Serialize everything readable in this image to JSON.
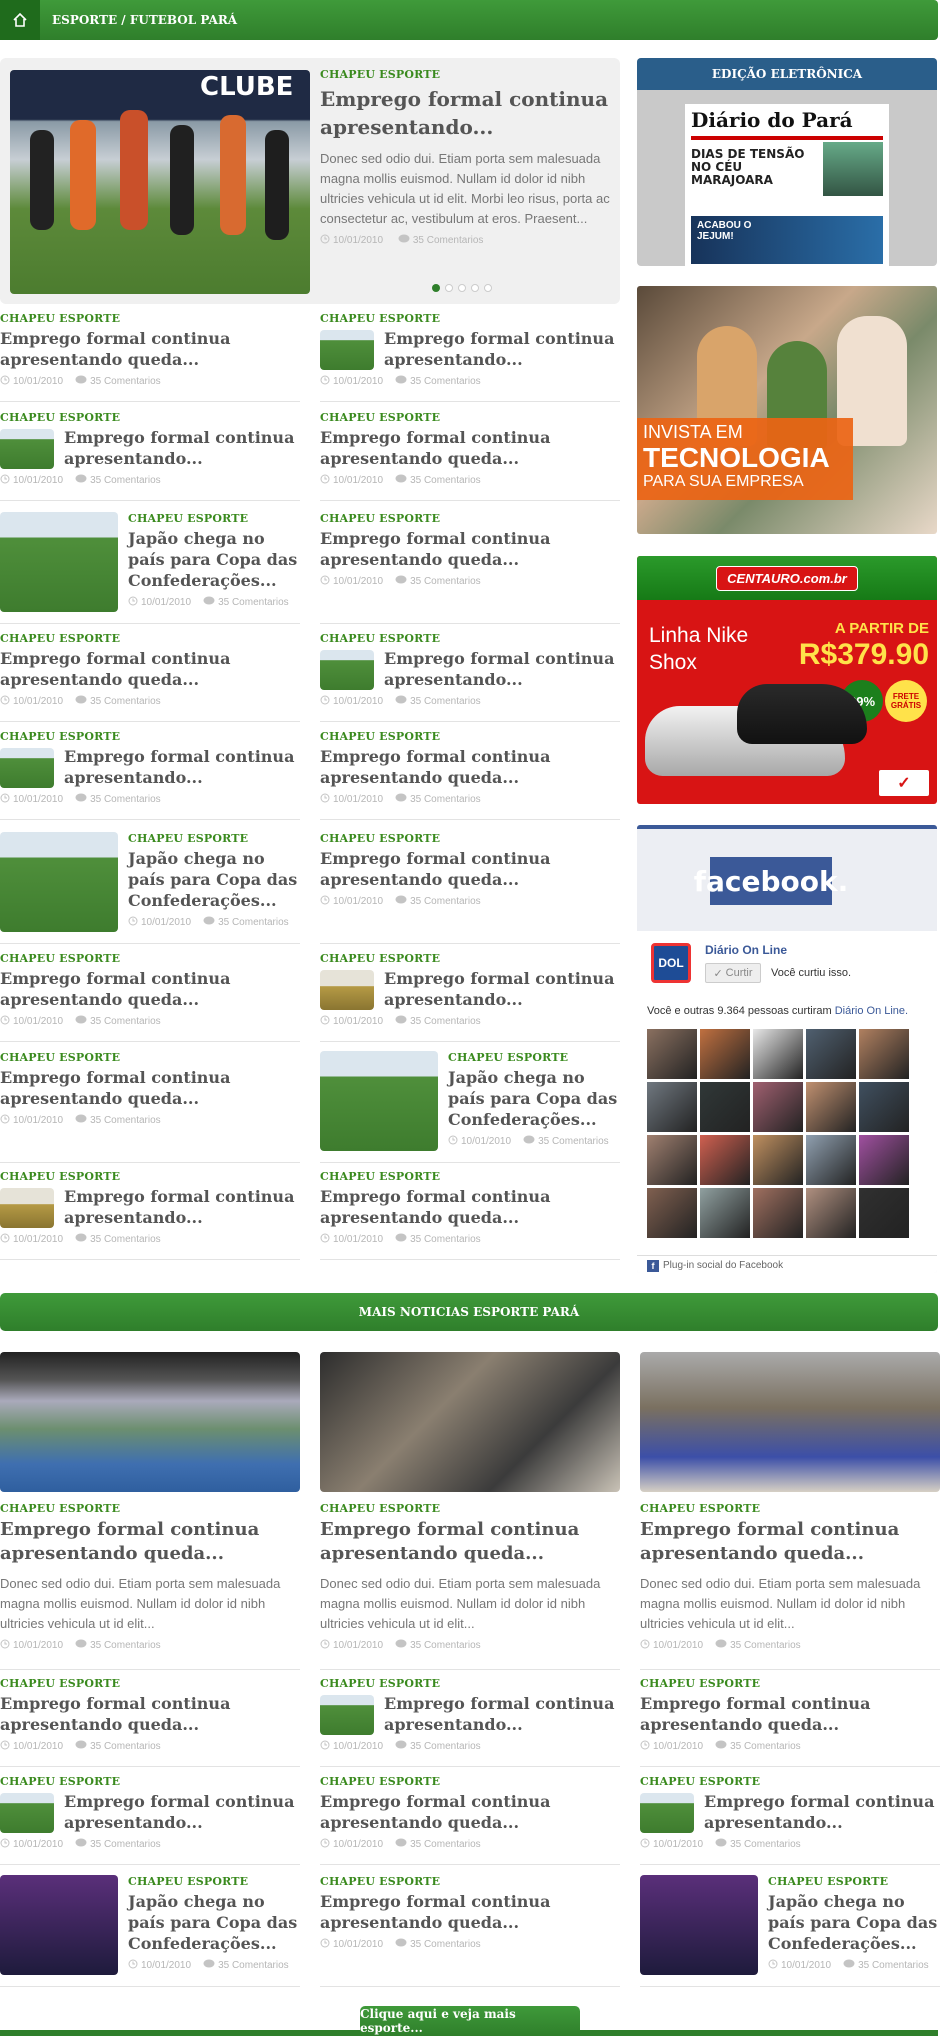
{
  "breadcrumb": "ESPORTE / FUTEBOL PARÁ",
  "kicker": "CHAPEU ESPORTE",
  "title_short": "Emprego formal continua apresentando...",
  "title_queda": "Emprego formal continua apresentando queda...",
  "title_japao": "Japão chega no país para Copa das Confederações...",
  "date": "10/01/2010",
  "comments": "35 Comentarios",
  "featured": {
    "title": "Emprego formal continua apresentando...",
    "desc": "Donec sed odio dui. Etiam porta sem malesuada magna mollis euismod. Nullam id dolor id nibh ultricies vehicula ut id elit. Morbi leo risus, porta ac consectetur ac, vestibulum at eros. Praesent...",
    "photo_text": "CLUBE"
  },
  "sidebar": {
    "edicao": "EDIÇÃO ELETRÔNICA",
    "paper_name": "Diário do Pará",
    "paper_head1": "DIAS DE TENSÃO NO CÉU MARAJOARA",
    "paper_head2": "ACABOU O JEJUM!",
    "ad1_line1": "INVISTA EM",
    "ad1_line2": "TECNOLOGIA",
    "ad1_line3": "PARA SUA EMPRESA",
    "ad2_brand": "CENTAURO.com.br",
    "ad2_product": "Linha Nike Shox",
    "ad2_apartir": "A PARTIR DE",
    "ad2_price": "R$379.90",
    "ad2_discount": "29%",
    "ad2_frete": "FRETE GRÁTIS",
    "fb_logo": "facebook.",
    "fb_page": "Diário On Line",
    "fb_curtir": "Curtir",
    "fb_liked": "Você curtiu isso.",
    "fb_others": "Você e outras 9.364 pessoas curtiram",
    "fb_others_link": "Diário On Line.",
    "fb_plugin": "Plug-in social do Facebook"
  },
  "mais": {
    "bar": "MAIS NOTICIAS ESPORTE PARÁ",
    "desc": "Donec sed odio dui. Etiam porta sem malesuada magna mollis euismod. Nullam id dolor id nibh ultricies vehicula ut id elit...",
    "more_button": "Clique aqui e veja mais esporte..."
  },
  "colors": {
    "green": "#2f7f2b",
    "kicker": "#3a8a1e",
    "fb_blue": "#3b5998"
  }
}
